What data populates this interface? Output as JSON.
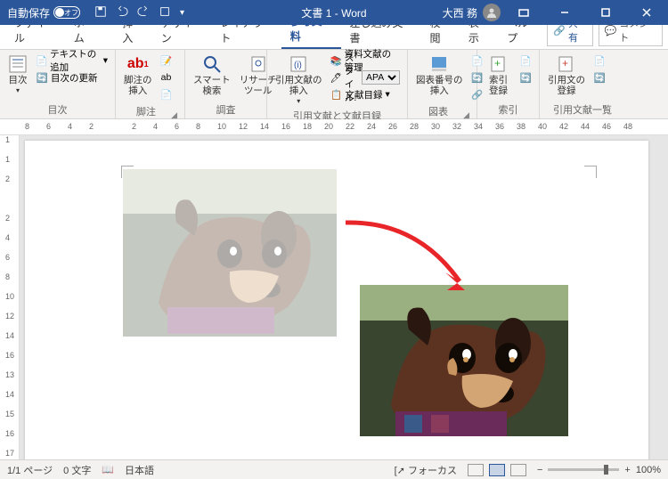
{
  "title": "文書 1  -  Word",
  "titlebar": {
    "autosave_label": "自動保存",
    "autosave_state": "オフ",
    "user_name": "大西 務"
  },
  "tabs": {
    "items": [
      "ファイル",
      "ホーム",
      "挿入",
      "デザイン",
      "レイアウト",
      "参考資料",
      "差し込み文書",
      "校閲",
      "表示",
      "ヘルプ"
    ],
    "active_index": 5,
    "share": "共有",
    "comment": "コメント"
  },
  "ribbon": {
    "groups": [
      {
        "label": "目次",
        "items": {
          "toc": "目次",
          "add_text": "テキストの追加",
          "update": "目次の更新"
        }
      },
      {
        "label": "脚注",
        "items": {
          "insert": "脚注の\n挿入",
          "ab": "ab"
        }
      },
      {
        "label": "調査",
        "items": {
          "smart": "スマート\n検索",
          "research": "リサーチ\nツール"
        }
      },
      {
        "label": "引用文献と文献目録",
        "items": {
          "insert_cite": "引用文献の\n挿入",
          "manage": "資料文献の管理",
          "style": "スタイル:",
          "style_value": "APA",
          "biblio": "文献目録"
        }
      },
      {
        "label": "図表",
        "items": {
          "caption": "図表番号の\n挿入"
        }
      },
      {
        "label": "索引",
        "items": {
          "mark": "索引登録"
        }
      },
      {
        "label": "引用文献一覧",
        "items": {
          "mark_cite": "引用文の\n登録"
        }
      }
    ]
  },
  "ruler_h": [
    8,
    6,
    4,
    2,
    "",
    2,
    4,
    6,
    8,
    10,
    12,
    14,
    16,
    18,
    20,
    22,
    24,
    26,
    28,
    30,
    32,
    34,
    36,
    38,
    40,
    42,
    44,
    46,
    48
  ],
  "ruler_v": [
    1,
    1,
    2,
    "",
    2,
    4,
    6,
    8,
    10,
    12,
    14,
    16,
    13,
    14,
    15,
    16,
    17
  ],
  "status": {
    "page": "1/1 ページ",
    "words": "0 文字",
    "lang": "日本語",
    "focus": "フォーカス",
    "zoom": "100%"
  }
}
